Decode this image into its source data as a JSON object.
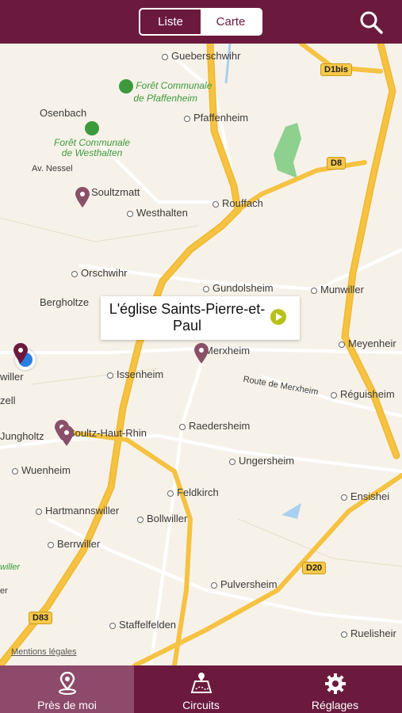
{
  "header": {
    "segment": {
      "list_label": "Liste",
      "map_label": "Carte",
      "selected": "Carte"
    },
    "search_icon": "search-icon"
  },
  "map": {
    "places": {
      "gueberschwihr": "Gueberschwihr",
      "osenbach": "Osenbach",
      "pfaffenheim": "Pfaffenheim",
      "soultzmatt": "Soultzmatt",
      "westhalten": "Westhalten",
      "rouffach": "Rouffach",
      "orschwihr": "Orschwihr",
      "bergholtzzell": "Bergholtze",
      "gundolsheim": "Gundolsheim",
      "munwiller": "Munwiller",
      "merxheim": "Merxheim",
      "meyenheim": "Meyenheir",
      "issenheim": "Issenheim",
      "guebwiller": "willer",
      "zell": "zell",
      "reguisheim": "Réguisheim",
      "jungholtz": "Jungholtz",
      "soultz": "Soultz-Haut-Rhin",
      "raedersheim": "Raedersheim",
      "ungersheim": "Ungersheim",
      "wuenheim": "Wuenheim",
      "ensisheim": "Ensishei",
      "feldkirch": "Feldkirch",
      "hartmannswiller": "Hartmannswiller",
      "bollwiller": "Bollwiller",
      "berrwiller": "Berrwiller",
      "pulversheim": "Pulversheim",
      "staffelfelden": "Staffelfelden",
      "ruelisheim": "Ruelisheir",
      "avnessel": "Av. Nessel",
      "route_merxheim": "Route de Merxheim",
      "edge_willer": "willer",
      "edge_er": "er"
    },
    "forests": {
      "pfaffenheim": [
        "Forêt Communale",
        "de Pfaffenheim"
      ],
      "westhalten": [
        "Forêt Communale",
        "de Westhalten"
      ]
    },
    "roads": {
      "d1bis": "D1bis",
      "d8": "D8",
      "d20": "D20",
      "d83": "D83"
    },
    "callout": {
      "title": "L'église Saints-Pierre-et-Paul"
    },
    "legal": "Mentions légales",
    "colors": {
      "pin": "#8a5068",
      "pin_selected": "#6b1a3e",
      "road": "#f5c242",
      "user": "#2a7fe0"
    }
  },
  "tabs": [
    {
      "label": "Près de moi",
      "icon": "location-pin-icon",
      "active": true
    },
    {
      "label": "Circuits",
      "icon": "map-route-icon",
      "active": false
    },
    {
      "label": "Réglages",
      "icon": "gear-icon",
      "active": false
    }
  ]
}
